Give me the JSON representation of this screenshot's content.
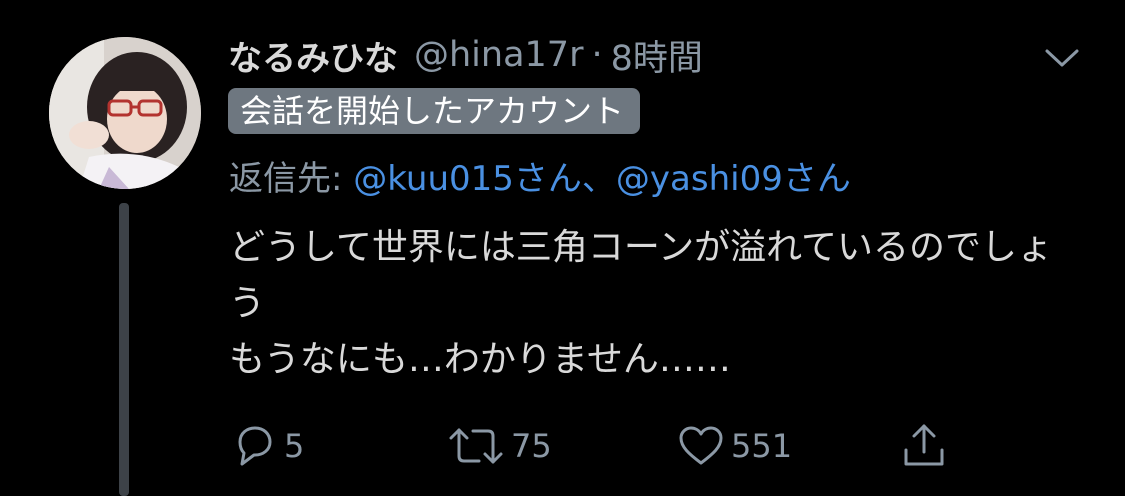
{
  "author": {
    "display_name": "なるみひな",
    "handle": "@hina17r",
    "separator": "·",
    "time": "8時間"
  },
  "badge": "会話を開始したアカウント",
  "reply": {
    "prefix": "返信先: ",
    "mention1": "@kuu015さん",
    "sep": "、",
    "mention2": "@yashi09さん"
  },
  "tweet": {
    "text": "どうして世界には三角コーンが溢れているのでしょう\nもうなにも…わかりません……"
  },
  "actions": {
    "reply_count": "5",
    "retweet_count": "75",
    "like_count": "551"
  },
  "colors": {
    "background": "#000000",
    "text": "#d9d9d9",
    "secondary": "#8b98a5",
    "link": "#4a90e2",
    "badge_bg": "#6e7780"
  },
  "icons": [
    "chevron-down-icon",
    "reply-icon",
    "retweet-icon",
    "like-icon",
    "share-icon"
  ]
}
